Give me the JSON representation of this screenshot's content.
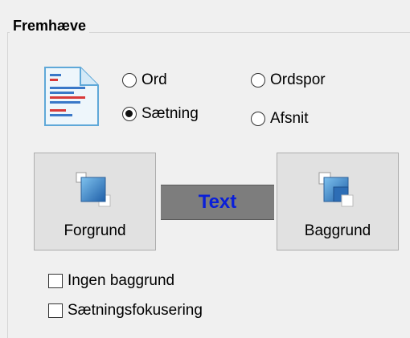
{
  "group": {
    "title": "Fremhæve"
  },
  "radios": {
    "ord": {
      "label": "Ord",
      "checked": false
    },
    "saetning": {
      "label": "Sætning",
      "checked": true
    },
    "ordspor": {
      "label": "Ordspor",
      "checked": false
    },
    "afsnit": {
      "label": "Afsnit",
      "checked": false
    }
  },
  "buttons": {
    "foreground": {
      "label": "Forgrund"
    },
    "background": {
      "label": "Baggrund"
    }
  },
  "preview": {
    "text": "Text",
    "text_color": "#0a1fd8",
    "background_color": "#7d7d7d"
  },
  "checkboxes": {
    "no_background": {
      "label": "Ingen baggrund",
      "checked": false
    },
    "sentence_focus": {
      "label": "Sætningsfokusering",
      "checked": false
    }
  }
}
